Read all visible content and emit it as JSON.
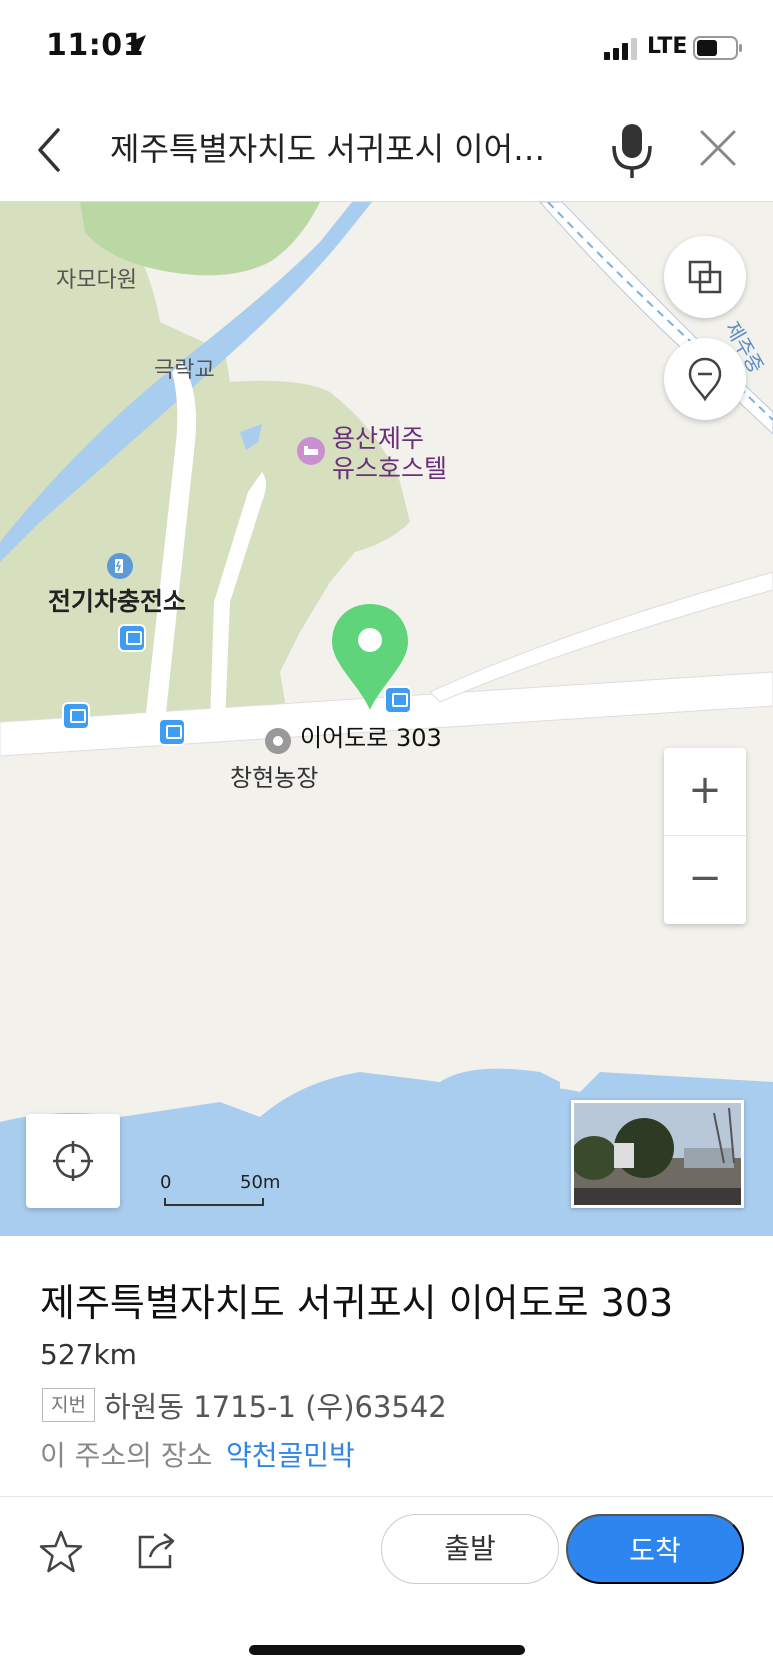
{
  "status_bar": {
    "time": "11:01",
    "network": "LTE"
  },
  "search": {
    "query": "제주특별자치도 서귀포시 이어…"
  },
  "map": {
    "labels": {
      "jamodawon": "자모다원",
      "geukrakgyo": "극락교",
      "hostel_line1": "용산제주",
      "hostel_line2": "유스호스텔",
      "ev_charger": "전기차충전소",
      "pin_address": "이어도로 303",
      "farm": "창현농장",
      "road_name": "제주중"
    },
    "scale": {
      "zero": "0",
      "max": "50m"
    },
    "controls": {
      "zoom_in": "+",
      "zoom_out": "−"
    }
  },
  "info": {
    "title": "제주특별자치도 서귀포시 이어도로 303",
    "distance": "527km",
    "jibun_badge": "지번",
    "jibun_text": "하원동 1715-1 (우)63542",
    "place_prefix": "이 주소의 장소",
    "place_link": "약천골민박"
  },
  "actions": {
    "depart": "출발",
    "arrive": "도착"
  },
  "colors": {
    "accent": "#2d86f0",
    "pin": "#5fd47a",
    "water": "#a9cdee",
    "park": "#d6dfbe"
  },
  "icons": [
    "location-arrow-icon",
    "back-icon",
    "mic-icon",
    "close-icon",
    "layers-icon",
    "pin-outline-icon",
    "locate-icon",
    "star-icon",
    "share-icon",
    "bus-stop-icon",
    "hotel-icon",
    "ev-charger-icon"
  ]
}
